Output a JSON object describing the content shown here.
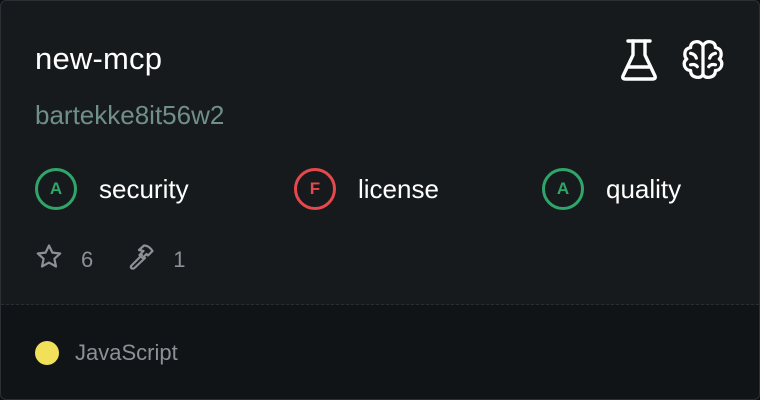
{
  "repo": {
    "name": "new-mcp",
    "author": "bartekke8it56w2"
  },
  "header_icons": [
    {
      "name": "flask-icon"
    },
    {
      "name": "brain-icon"
    }
  ],
  "grades": [
    {
      "letter": "A",
      "label": "security",
      "status": "pass"
    },
    {
      "letter": "F",
      "label": "license",
      "status": "fail"
    },
    {
      "letter": "A",
      "label": "quality",
      "status": "pass"
    }
  ],
  "stats": {
    "stars": "6",
    "tools": "1"
  },
  "language": {
    "name": "JavaScript",
    "color": "#f1e05a"
  }
}
